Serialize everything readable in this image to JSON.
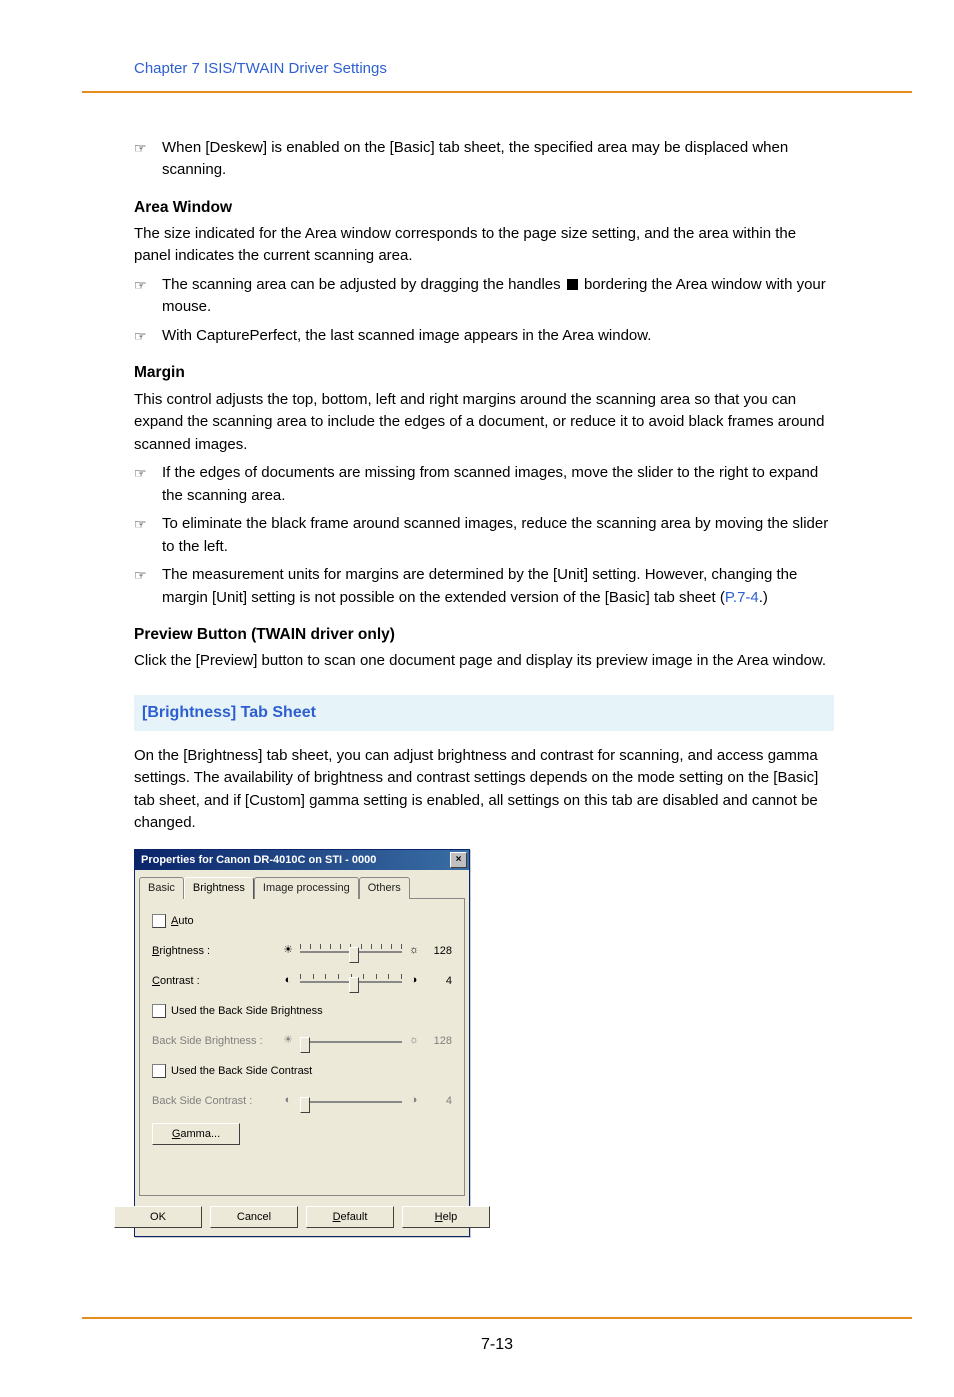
{
  "header": {
    "chapter": "Chapter 7   ISIS/TWAIN Driver Settings"
  },
  "note1": "When [Deskew] is enabled on the [Basic] tab sheet, the specified area may be displaced when scanning.",
  "area_window": {
    "title": "Area Window",
    "body": "The size indicated for the Area window corresponds to the page size setting, and the area within the panel indicates the current scanning area.",
    "n1a": "The scanning area can be adjusted by dragging the handles ",
    "n1b": " bordering the Area window with your mouse.",
    "n2": "With CapturePerfect, the last scanned image appears in the Area window."
  },
  "margin": {
    "title": "Margin",
    "body": "This control adjusts the top, bottom, left and right margins around the scanning area so that you can expand the scanning area to include the edges of a document, or reduce it to avoid black frames around scanned images.",
    "n1": "If the edges of documents are missing from scanned images, move the slider to the right to expand the scanning area.",
    "n2": "To eliminate the black frame around scanned images, reduce the scanning area by moving the slider to the left.",
    "n3a": "The measurement units for margins are determined by the [Unit] setting. However, changing the margin [Unit] setting is not possible on the extended version of the [Basic] tab sheet (",
    "n3link": "P.7-4",
    "n3b": ".)"
  },
  "preview": {
    "title": "Preview Button (TWAIN driver only)",
    "body": "Click the [Preview] button to scan one document page and display its preview image in the Area window."
  },
  "brightness_section": {
    "title": "[Brightness] Tab Sheet",
    "body": "On the [Brightness] tab sheet, you can adjust brightness and contrast for scanning, and access gamma settings. The availability of brightness and contrast settings depends on the mode setting on the [Basic] tab sheet, and if [Custom] gamma setting is enabled, all settings on this tab are disabled and cannot be changed."
  },
  "dialog": {
    "title": "Properties for Canon DR-4010C on STI - 0000",
    "tabs": [
      "Basic",
      "Brightness",
      "Image processing",
      "Others"
    ],
    "auto_label": "Auto",
    "brightness_label": "Brightness :",
    "brightness_value": "128",
    "contrast_label": "Contrast :",
    "contrast_value": "4",
    "use_back_bright": "Used the Back Side Brightness",
    "back_bright_label": "Back Side Brightness :",
    "back_bright_value": "128",
    "use_back_contrast": "Used the Back Side Contrast",
    "back_contrast_label": "Back Side Contrast :",
    "back_contrast_value": "4",
    "gamma_btn": "Gamma...",
    "ok": "OK",
    "cancel": "Cancel",
    "default": "Default",
    "help": "Help"
  },
  "page_number": "7-13",
  "pointer_glyph": "☞"
}
